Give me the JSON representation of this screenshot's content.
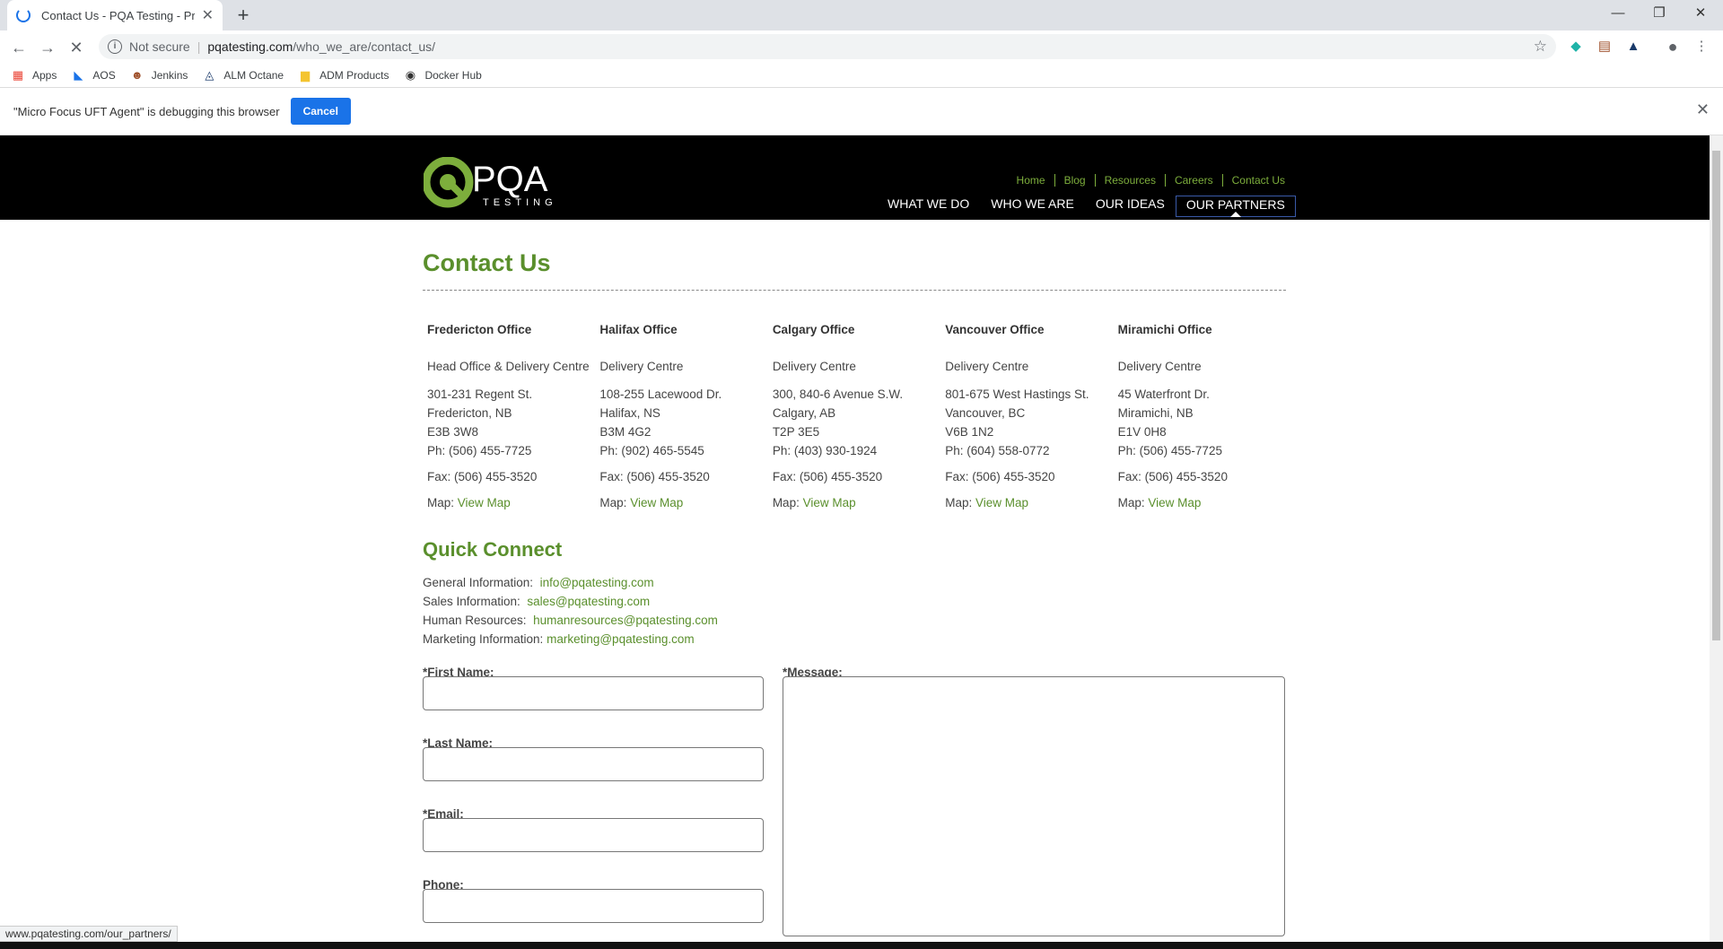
{
  "browser": {
    "tab_title": "Contact Us - PQA Testing - Profe",
    "url_security": "Not secure",
    "url_host": "pqatesting.com",
    "url_path": "/who_we_are/contact_us/",
    "bookmarks": [
      "Apps",
      "AOS",
      "Jenkins",
      "ALM Octane",
      "ADM Products",
      "Docker Hub"
    ],
    "infobar_text": "\"Micro Focus UFT Agent\" is debugging this browser",
    "infobar_cancel": "Cancel",
    "status_url": "www.pqatesting.com/our_partners/"
  },
  "site": {
    "logo_text": "PQA",
    "logo_sub": "TESTING",
    "util_nav": [
      "Home",
      "Blog",
      "Resources",
      "Careers",
      "Contact Us"
    ],
    "main_nav": [
      "WHAT WE DO",
      "WHO WE ARE",
      "OUR IDEAS",
      "OUR PARTNERS"
    ],
    "accent_color": "#5a8f2c"
  },
  "page": {
    "title": "Contact Us",
    "offices": [
      {
        "name": "Fredericton Office",
        "type": "Head Office & Delivery Centre",
        "addr1": "301-231 Regent St.",
        "addr2": "Fredericton, NB",
        "addr3": "E3B 3W8",
        "ph": "Ph: (506) 455-7725",
        "fax": "Fax: (506) 455-3520",
        "map_label": "Map:",
        "map_link": "View Map"
      },
      {
        "name": "Halifax Office",
        "type": "Delivery Centre",
        "addr1": "108-255 Lacewood Dr.",
        "addr2": "Halifax, NS",
        "addr3": "B3M 4G2",
        "ph": "Ph: (902) 465-5545",
        "fax": "Fax: (506) 455-3520",
        "map_label": "Map:",
        "map_link": "View Map"
      },
      {
        "name": "Calgary Office",
        "type": "Delivery Centre",
        "addr1": "300, 840-6 Avenue S.W.",
        "addr2": "Calgary, AB",
        "addr3": "T2P 3E5",
        "ph": "Ph: (403) 930-1924",
        "fax": "Fax: (506) 455-3520",
        "map_label": "Map:",
        "map_link": "View Map"
      },
      {
        "name": "Vancouver Office",
        "type": "Delivery Centre",
        "addr1": "801-675 West Hastings St.",
        "addr2": "Vancouver, BC",
        "addr3": "V6B 1N2",
        "ph": "Ph: (604) 558-0772",
        "fax": "Fax: (506) 455-3520",
        "map_label": "Map:",
        "map_link": "View Map"
      },
      {
        "name": "Miramichi Office",
        "type": "Delivery Centre",
        "addr1": "45 Waterfront Dr.",
        "addr2": "Miramichi, NB",
        "addr3": "E1V 0H8",
        "ph": "Ph: (506) 455-7725",
        "fax": "Fax: (506) 455-3520",
        "map_label": "Map:",
        "map_link": "View Map"
      }
    ],
    "quick_connect_title": "Quick Connect",
    "quick_connect": [
      {
        "label": "General Information:",
        "email": "info@pqatesting.com"
      },
      {
        "label": "Sales Information:",
        "email": "sales@pqatesting.com"
      },
      {
        "label": "Human Resources:",
        "email": "humanresources@pqatesting.com"
      },
      {
        "label": "Marketing Information:",
        "email": "marketing@pqatesting.com"
      }
    ],
    "form": {
      "first_name": "First Name:",
      "last_name": "Last Name:",
      "email": "Email:",
      "phone": "Phone:",
      "message": "Message:",
      "required_mark": "*"
    }
  }
}
